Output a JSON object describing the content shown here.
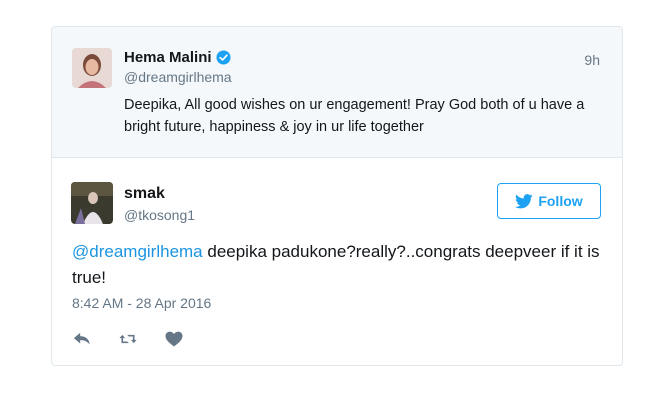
{
  "parent_tweet": {
    "author_name": "Hema Malini",
    "verified_icon": "verified-badge-icon",
    "author_handle": "@dreamgirlhema",
    "time_ago": "9h",
    "text": "Deepika, All good wishes on ur engagement! Pray God both of u have a bright future, happiness & joy in ur life together"
  },
  "main_tweet": {
    "author_name": "smak",
    "author_handle": "@tkosong1",
    "follow_label": "Follow",
    "mention": "@dreamgirlhema",
    "text": " deepika padukone?really?..congrats deepveer if it is true!",
    "timestamp": "8:42 AM - 28 Apr 2016"
  },
  "actions": {
    "reply_icon": "reply-icon",
    "retweet_icon": "retweet-icon",
    "like_icon": "heart-icon"
  },
  "colors": {
    "accent": "#1da1f2",
    "mention": "#1b95e0",
    "secondary_text": "#657786",
    "parent_bg": "#f5f8fa",
    "border": "#e1e8ed"
  }
}
